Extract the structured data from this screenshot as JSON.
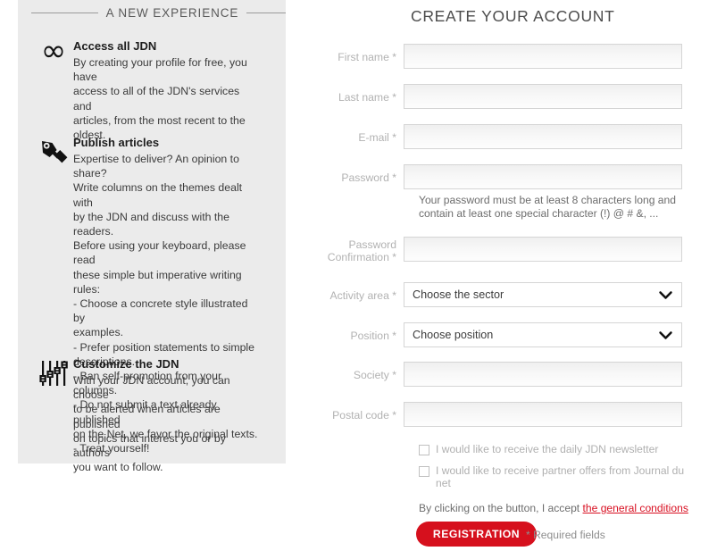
{
  "left_panel": {
    "section_title": "A NEW EXPERIENCE",
    "features": [
      {
        "icon": "infinity-icon",
        "title": "Access all JDN",
        "lines": [
          "By creating your profile for free, you have",
          "access to all of the JDN's services and",
          "articles, from the most recent to the",
          "oldest."
        ]
      },
      {
        "icon": "pen-nib-icon",
        "title": "Publish articles",
        "lines": [
          "Expertise to deliver? An opinion to share?",
          "Write columns on the themes dealt with",
          "by the JDN and discuss with the readers.",
          "Before using your keyboard, please read",
          "these simple but imperative writing rules:",
          "- Choose a concrete style illustrated by",
          "examples.",
          "- Prefer position statements to simple",
          "descriptions.",
          "- Ban self-promotion from your columns.",
          "- Do not submit a text already published",
          "on the Net, we favor the original texts.",
          "- Treat yourself!"
        ]
      },
      {
        "icon": "sliders-icon",
        "title": "Customize the JDN",
        "lines": [
          "With your JDN account, you can choose",
          "to be alerted when articles are published",
          "on topics that interest you or by authors",
          "you want to follow."
        ]
      }
    ]
  },
  "form": {
    "heading": "CREATE YOUR ACCOUNT",
    "fields": {
      "first_name": {
        "label": "First name *",
        "value": "",
        "placeholder": ""
      },
      "last_name": {
        "label": "Last name *",
        "value": "",
        "placeholder": ""
      },
      "email": {
        "label": "E-mail *",
        "value": "",
        "placeholder": ""
      },
      "password": {
        "label": "Password *",
        "value": "",
        "placeholder": ""
      },
      "password_confirmation": {
        "label_line1": "Password",
        "label_line2": "Confirmation *",
        "value": "",
        "placeholder": ""
      },
      "activity_area": {
        "label": "Activity area *",
        "selected": "Choose the sector"
      },
      "position": {
        "label": "Position *",
        "selected": "Choose position"
      },
      "society": {
        "label": "Society *",
        "value": "",
        "placeholder": ""
      },
      "postal_code": {
        "label": "Postal code *",
        "value": "",
        "placeholder": ""
      }
    },
    "password_hint": {
      "line1": "Your password must be at least 8 characters long and",
      "line2": "contain at least one special character (!) @ # &, ..."
    },
    "checkboxes": [
      {
        "label_line1": "I would like to receive the daily JDN newsletter",
        "label_line2": "",
        "checked": false
      },
      {
        "label_line1": "I would like to receive partner offers from Journal du",
        "label_line2": "net",
        "checked": false
      }
    ],
    "accept_prefix": "By clicking on the button, I accept ",
    "accept_link": "the general conditions",
    "submit_label": "REGISTRATION",
    "required_note": "* Required fields",
    "accent_color": "#d6101d",
    "link_color": "#d81022"
  }
}
